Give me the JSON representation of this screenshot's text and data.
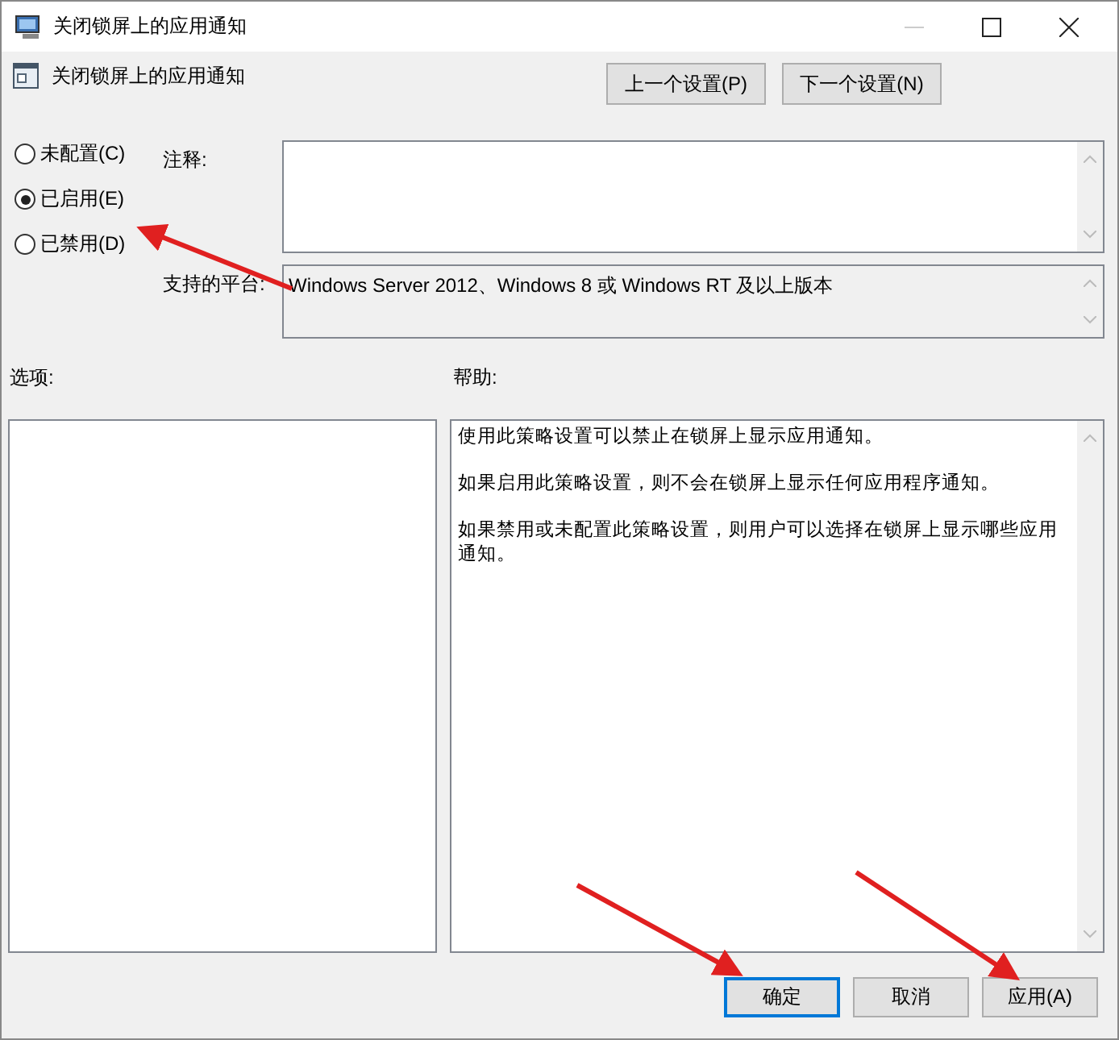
{
  "window": {
    "title": "关闭锁屏上的应用通知"
  },
  "header": {
    "title": "关闭锁屏上的应用通知",
    "buttons": [
      "上一个设置(P)",
      "下一个设置(N)"
    ]
  },
  "states": [
    {
      "label": "未配置(C)",
      "selected": false
    },
    {
      "label": "已启用(E)",
      "selected": true
    },
    {
      "label": "已禁用(D)",
      "selected": false
    }
  ],
  "comment": {
    "label": "注释:"
  },
  "supported_on": {
    "label": "支持的平台:",
    "value": "Windows Server 2012、Windows 8 或 Windows RT 及以上版本"
  },
  "options": {
    "label": "选项:"
  },
  "help": {
    "label": "帮助:",
    "paragraphs": [
      "使用此策略设置可以禁止在锁屏上显示应用通知。",
      "如果启用此策略设置，则不会在锁屏上显示任何应用程序通知。",
      "如果禁用或未配置此策略设置，则用户可以选择在锁屏上显示哪些应用通知。"
    ]
  },
  "buttons": [
    {
      "label": "确定",
      "default": true
    },
    {
      "label": "取消",
      "default": false
    },
    {
      "label": "应用(A)",
      "default": false
    }
  ]
}
